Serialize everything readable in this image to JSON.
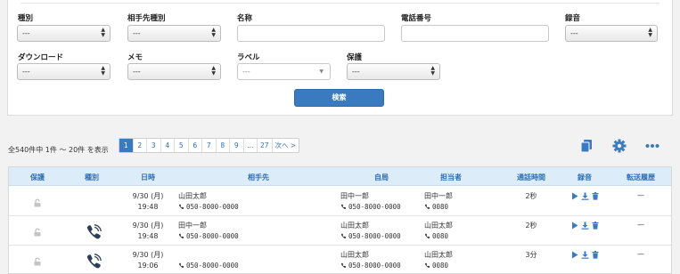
{
  "filters": {
    "type_label": "種別",
    "party_type_label": "相手先種別",
    "name_label": "名称",
    "phone_label": "電話番号",
    "recording_label": "録音",
    "download_label": "ダウンロード",
    "memo_label": "メモ",
    "label_label": "ラベル",
    "protect_label": "保護",
    "dash": "---",
    "search_label": "検索"
  },
  "summary": {
    "count_text": "全540件中 1件 〜 20件 を表示"
  },
  "pagination": {
    "pages": [
      "1",
      "2",
      "3",
      "4",
      "5",
      "6",
      "7",
      "8",
      "9",
      "...",
      "27",
      "次へ >"
    ],
    "active": "1"
  },
  "table": {
    "headers": [
      "保護",
      "種別",
      "日時",
      "相手先",
      "自局",
      "担当者",
      "通話時間",
      "録音",
      "転送履歴"
    ],
    "rows": [
      {
        "date": "9/30 (月)",
        "time": "19:48",
        "party_name": "山田太郎",
        "party_phone": "050-8000-0000",
        "self_name": "田中一郎",
        "self_phone": "050-8000-0000",
        "staff_name": "田中一郎",
        "staff_ext": "0080",
        "duration": "2秒",
        "transfer": "—",
        "call_icon": false
      },
      {
        "date": "9/30 (月)",
        "time": "19:48",
        "party_name": "田中一郎",
        "party_phone": "050-8000-0000",
        "self_name": "山田太郎",
        "self_phone": "050-8000-0000",
        "staff_name": "山田太郎",
        "staff_ext": "0080",
        "duration": "2秒",
        "transfer": "—",
        "call_icon": true
      },
      {
        "date": "9/30 (月)",
        "time": "19:06",
        "party_name": "",
        "party_phone": "050-8000-0000",
        "self_name": "山田太郎",
        "self_phone": "050-8000-0000",
        "staff_name": "山田太郎",
        "staff_ext": "0080",
        "duration": "3分",
        "transfer": "—",
        "call_icon": true
      }
    ]
  },
  "colors": {
    "accent": "#3a7bbf",
    "header_bg": "#dcecf8"
  },
  "icons": {
    "copy": "copy-icon",
    "settings": "gear-icon",
    "more": "more-icon",
    "lock": "lock-icon",
    "phone": "phone-icon",
    "play": "play-icon",
    "download": "download-icon",
    "delete": "trash-icon"
  }
}
